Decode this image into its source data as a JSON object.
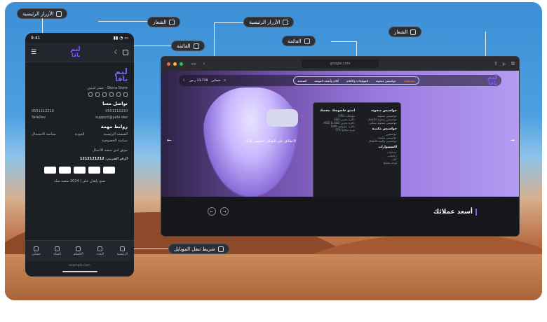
{
  "callouts": {
    "home_buttons_top": "الأزرار الرئيسية",
    "logo_phone": "الشعار",
    "menu_phone": "القائمة",
    "home_buttons_browser": "الأزرار الرئيسية",
    "menu_browser": "القائمة",
    "logo_browser": "الشعار",
    "mobile_nav": "شريط تنقل الموبايل"
  },
  "phone": {
    "status_time": "9:41",
    "logo_line1": "ليم",
    "logo_line2": "يافا",
    "address": "Dorra Store - عمنر لديبين",
    "contact_title": "تواصل معنا",
    "phone1": "0551112210",
    "phone2": "0551112210",
    "email": "support@yafa.dev",
    "user": "YafaDev",
    "links_title": "روابط مهمة",
    "link1": "الصفحة الرئيسية",
    "link2": "الجودة",
    "link3": "سياسة الاستبدال",
    "link4": "سياسة الخصوصية",
    "platform": "موثق لدى منصة الاعمال",
    "tax_label": "الرقم الضريبي:",
    "tax_number": "1212121212",
    "copyright": "صنع بإتقان على | 2024 منصة سلة",
    "nav": [
      "الرئيسية",
      "البحث",
      "الأقسام",
      "السلة",
      "حسابي"
    ],
    "url": "example.com"
  },
  "browser": {
    "url": "google.com",
    "nav_links": [
      "تخفيضات",
      "جواسيس منحوتة",
      "الموبايلات والأقلام",
      "أقلام وأنقحة الموضة",
      "الصفحة"
    ],
    "mega_col1_title": "جواسيس منحوتة",
    "mega_col1_items": [
      "جواسيس منحوتة",
      "جواسيس منحوتة للأطفال",
      "جواسيس منحوتة نسائي"
    ],
    "mega_col1_title2": "جواسيس مكتبية",
    "mega_col1_items2": [
      "جواسيس",
      "جواسيس مكتبية",
      "جواسيس مكتبية للأطفال"
    ],
    "mega_col1_title3": "اكسسوارات",
    "mega_col1_items3": [
      "سماعات",
      "زجاجات",
      "علب",
      "لوحة مفاتيح"
    ],
    "mega_col2_title": "اصنع جاسوسك بنفسك",
    "mega_col2_items": [
      "موبايلات GPU",
      "ذاكرة تخزين SSD",
      "ذاكرة تخزين HDD & SSD",
      "ذاكرة عشوائية RAM",
      "تبريد معالج CPU"
    ],
    "hero_text": "الانطلاق على الشكل الحقيقي كأنك",
    "clients_title": "أسعد عملائك",
    "account": "حسابي",
    "cart_total": "13,719 ر.س"
  }
}
